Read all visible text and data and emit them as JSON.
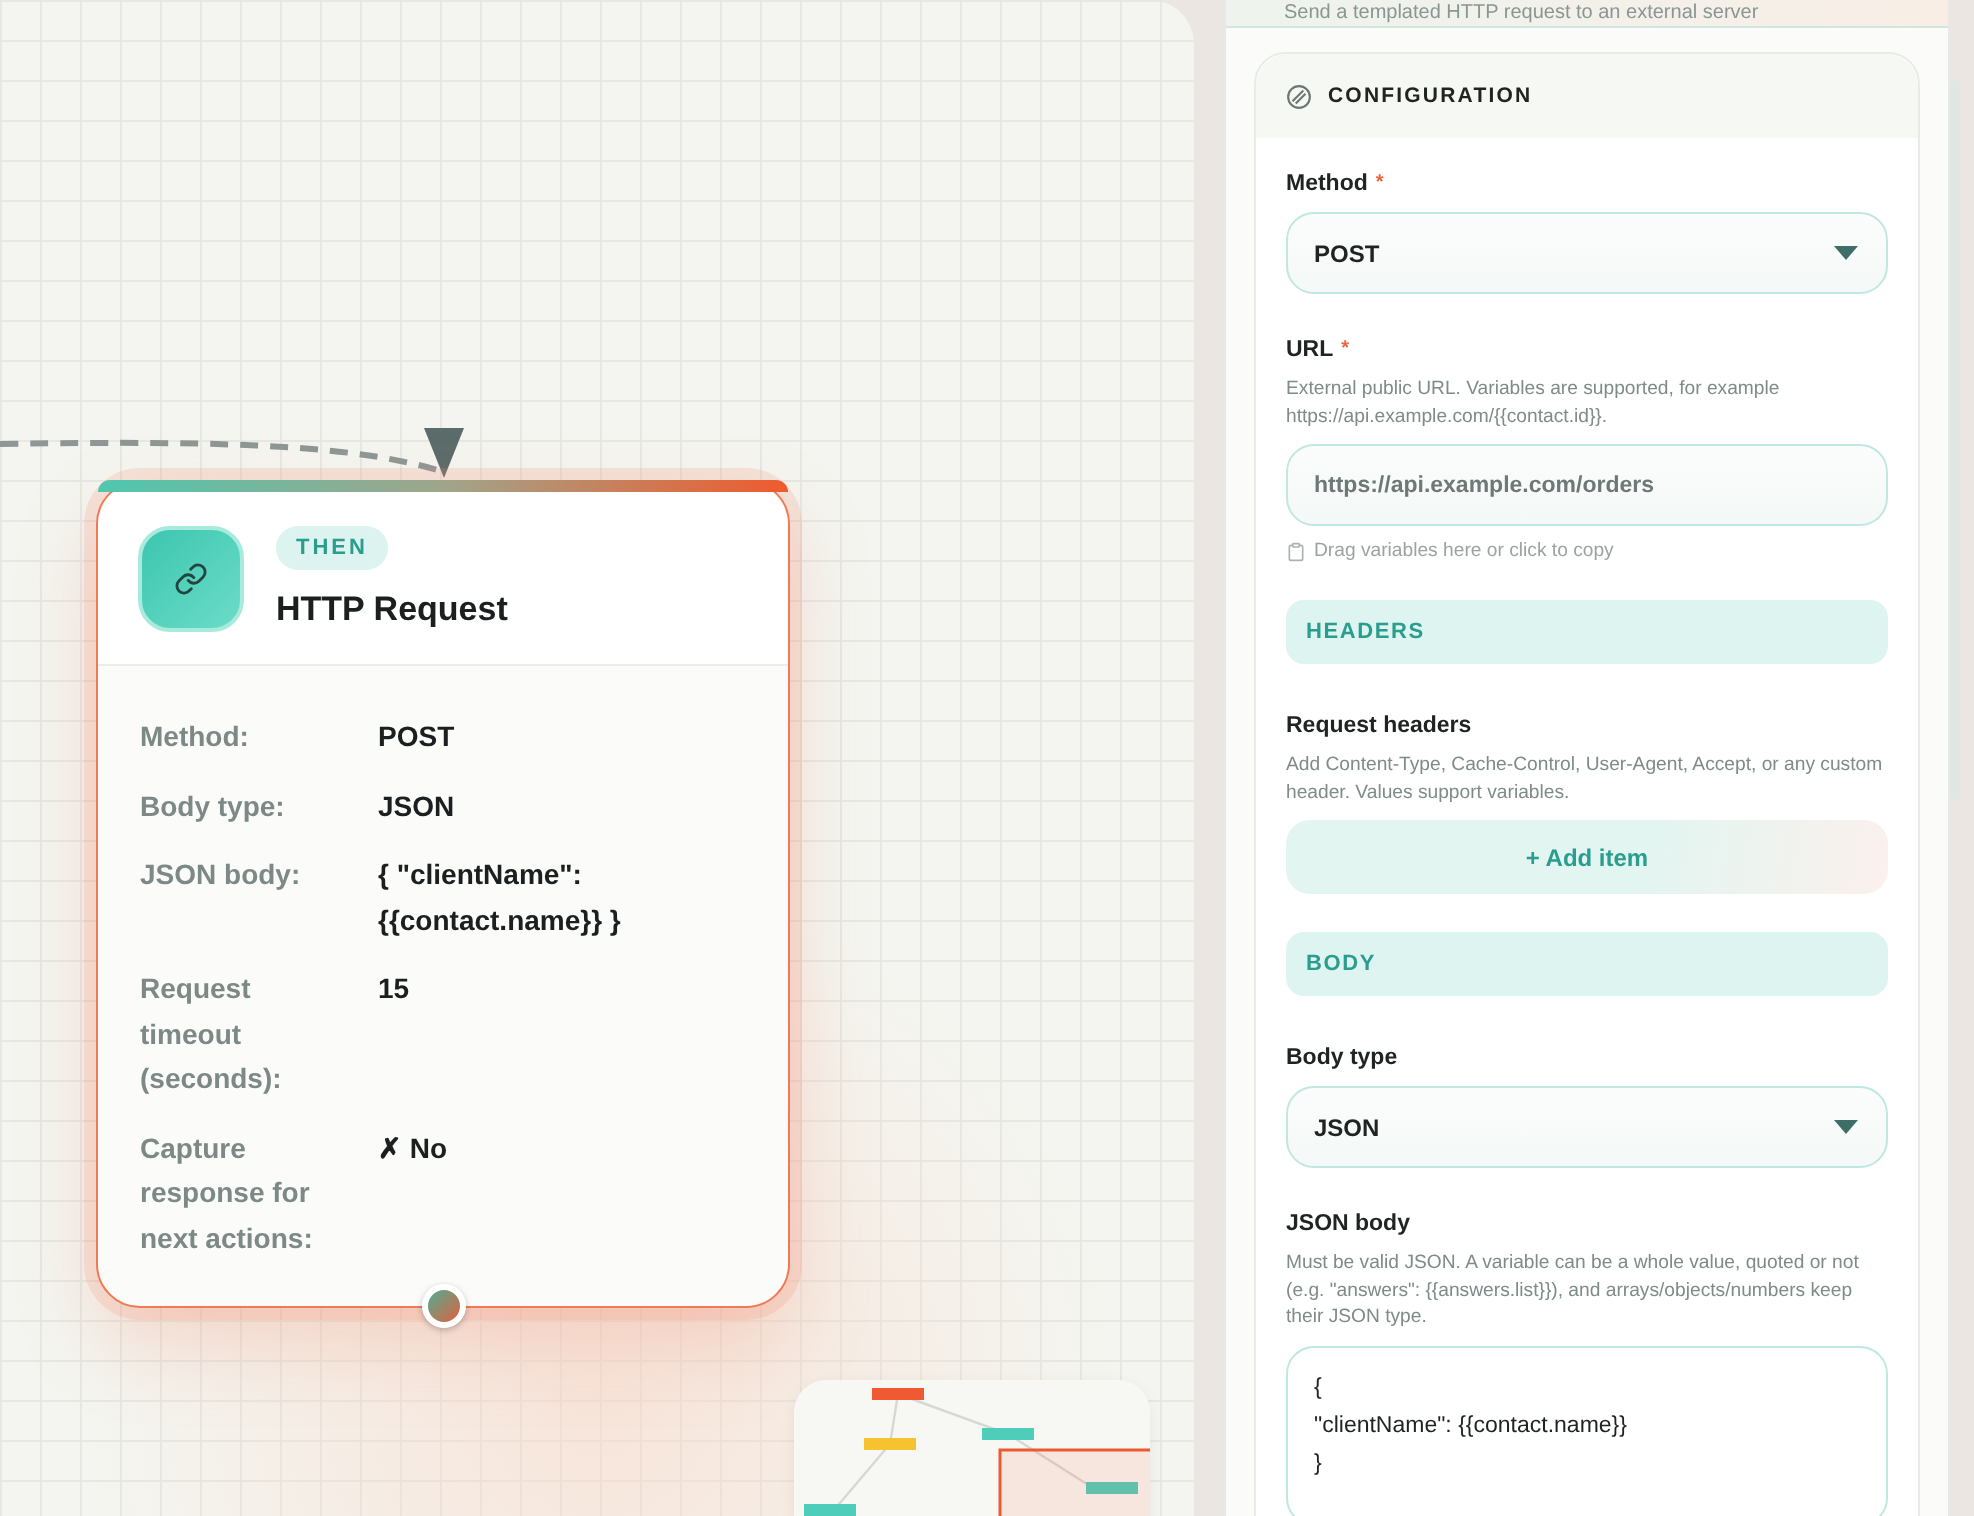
{
  "canvas": {
    "node": {
      "badge": "THEN",
      "title": "HTTP Request",
      "fields": [
        {
          "label": "Method:",
          "value": "POST"
        },
        {
          "label": "Body type:",
          "value": "JSON"
        },
        {
          "label": "JSON body:",
          "value": "{ \"clientName\": {{contact.name}} }"
        },
        {
          "label": "Request timeout (seconds):",
          "value": "15"
        },
        {
          "label": "Capture response for next actions:",
          "value": "✗ No"
        }
      ]
    }
  },
  "panel": {
    "subtitle": "Send a templated HTTP request to an external server",
    "section_title": "CONFIGURATION",
    "items": [
      {
        "kind": "select",
        "label": "Method",
        "required_mark": "*",
        "value": "POST"
      },
      {
        "kind": "input",
        "label": "URL",
        "required_mark": "*",
        "help": "External public URL. Variables are supported, for example https://api.example.com/{{contact.id}}.",
        "placeholder": "https://api.example.com/orders",
        "hint": "Drag variables here or click to copy"
      },
      {
        "kind": "section",
        "title": "HEADERS"
      },
      {
        "kind": "list",
        "label": "Request headers",
        "help": "Add Content-Type, Cache-Control, User-Agent, Accept, or any custom header. Values support variables.",
        "button": "+ Add item"
      },
      {
        "kind": "section",
        "title": "BODY"
      },
      {
        "kind": "select",
        "label": "Body type",
        "value": "JSON"
      },
      {
        "kind": "textarea",
        "label": "JSON body",
        "help": "Must be valid JSON. A variable can be a whole value, quoted or not (e.g. \"answers\": {{answers.list}}), and arrays/objects/numbers keep their JSON type.",
        "value": "{\n\"clientName\": {{contact.name}}\n}"
      }
    ]
  }
}
